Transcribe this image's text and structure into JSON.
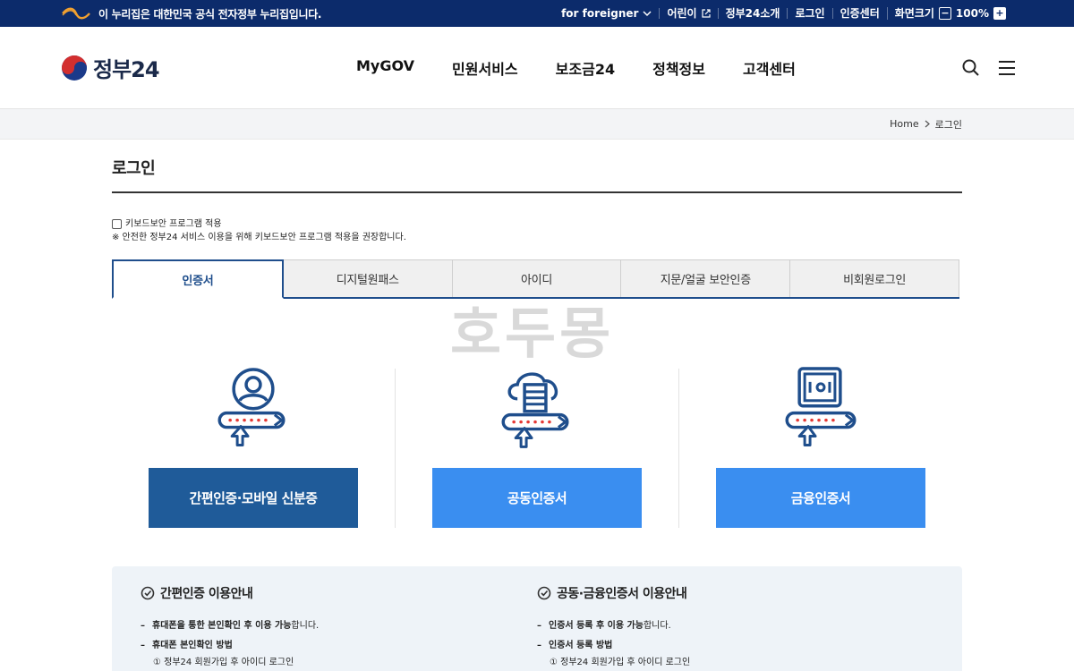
{
  "topbar": {
    "notice": "이 누리집은 대한민국 공식 전자정부 누리집입니다.",
    "foreigner": "for foreigner",
    "kids": "어린이",
    "about": "정부24소개",
    "login": "로그인",
    "cert_center": "인증센터",
    "screen_size": "화면크기",
    "zoom": "100%"
  },
  "header": {
    "logo": "정부24",
    "nav": [
      "MyGOV",
      "민원서비스",
      "보조금24",
      "정책정보",
      "고객센터"
    ]
  },
  "breadcrumb": {
    "home": "Home",
    "current": "로그인"
  },
  "page": {
    "title": "로그인",
    "keyboard_label": "키보드보안 프로그램 적용",
    "keyboard_note": "※ 안전한 정부24 서비스 이용을 위해 키보드보안 프로그램 적용을 권장합니다."
  },
  "tabs": [
    "인증서",
    "디지털원패스",
    "아이디",
    "지문/얼굴 보안인증",
    "비회원로그인"
  ],
  "watermark": "호두몽",
  "methods": [
    "간편인증·모바일 신분증",
    "공동인증서",
    "금융인증서"
  ],
  "guide": {
    "left": {
      "title": "간편인증 이용안내",
      "item1_bold": "휴대폰을 통한 본인확인 후 이용 가능",
      "item1_rest": "합니다.",
      "item2_bold": "휴대폰 본인확인 방법",
      "item2_sub": "① 정부24 회원가입 후 아이디 로그인"
    },
    "right": {
      "title": "공동·금융인증서 이용안내",
      "item1_bold": "인증서 등록 후 이용 가능",
      "item1_rest": "합니다.",
      "item2_bold": "인증서 등록 방법",
      "item2_sub": "① 정부24 회원가입 후 아이디 로그인"
    }
  },
  "colors": {
    "gov_blue": "#0c2b6b",
    "tab_blue": "#1f4e8c",
    "btn_dark": "#1f5b99",
    "btn_light": "#3a8ef0",
    "icon_red": "#e53935"
  }
}
